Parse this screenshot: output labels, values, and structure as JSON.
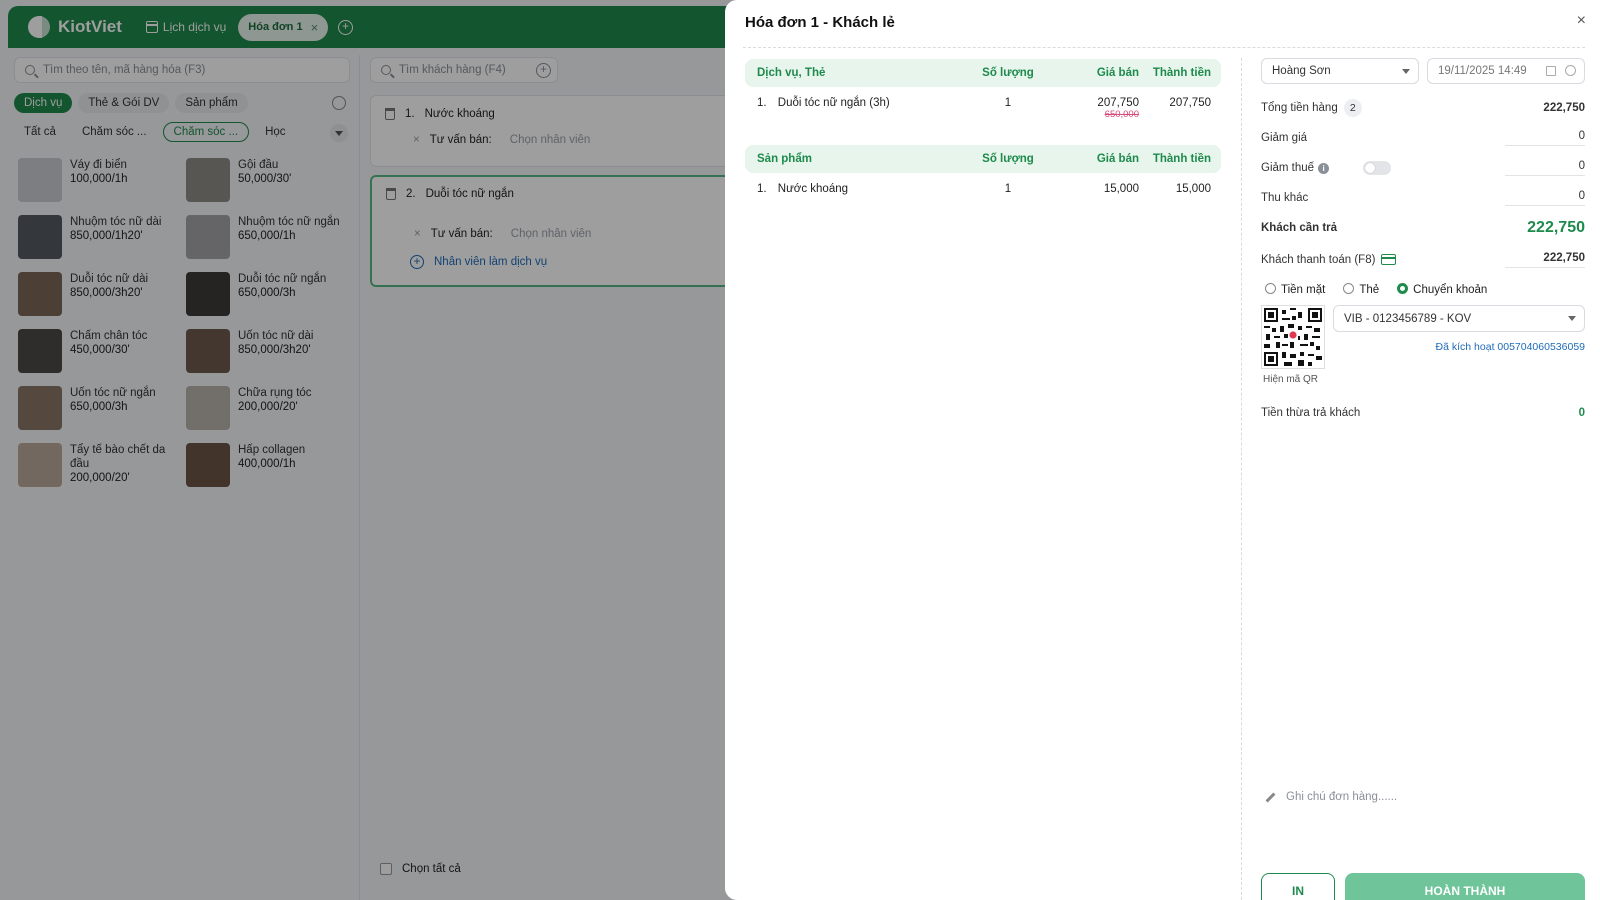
{
  "topbar": {
    "brand": "KiotViet",
    "nav_schedule": "Lịch dịch vụ",
    "active_tab": "Hóa đơn 1"
  },
  "left": {
    "search_placeholder": "Tìm theo tên, mã hàng hóa (F3)",
    "categories": [
      "Dịch vụ",
      "Thẻ & Gói DV",
      "Sản phẩm"
    ],
    "subcategories": [
      "Tất cả",
      "Chăm sóc ...",
      "Chăm sóc ...",
      "Học"
    ],
    "services": [
      {
        "name": "Váy đi biển",
        "price": "100,000/1h"
      },
      {
        "name": "Gội đầu",
        "price": "50,000/30'"
      },
      {
        "name": "Nhuộm tóc nữ dài",
        "price": "850,000/1h20'"
      },
      {
        "name": "Nhuộm tóc nữ ngắn",
        "price": "650,000/1h"
      },
      {
        "name": "Duỗi tóc nữ dài",
        "price": "850,000/3h20'"
      },
      {
        "name": "Duỗi tóc nữ ngắn",
        "price": "650,000/3h"
      },
      {
        "name": "Chấm chân tóc",
        "price": "450,000/30'"
      },
      {
        "name": "Uốn tóc nữ dài",
        "price": "850,000/3h20'"
      },
      {
        "name": "Uốn tóc nữ ngắn",
        "price": "650,000/3h"
      },
      {
        "name": "Chữa rụng tóc",
        "price": "200,000/20'"
      },
      {
        "name": "Tẩy tế bào chết da đầu",
        "price": "200,000/20'"
      },
      {
        "name": "Hấp collagen",
        "price": "400,000/1h"
      }
    ]
  },
  "middle": {
    "customer_placeholder": "Tìm khách hàng (F4)",
    "items": [
      {
        "index": "1.",
        "name": "Nước khoáng"
      },
      {
        "index": "2.",
        "name": "Duỗi tóc nữ ngắn"
      }
    ],
    "consultant_label": "Tư vấn bán:",
    "consultant_placeholder": "Chọn nhân viên",
    "add_staff": "Nhân viên làm dịch vụ",
    "select_all": "Chọn tất cả"
  },
  "drawer": {
    "title": "Hóa đơn 1 - Khách lẻ",
    "close": "×",
    "columns": {
      "qty": "Số lượng",
      "price": "Giá bán",
      "total": "Thành tiền"
    },
    "services_header": "Dịch vụ, Thẻ",
    "services": [
      {
        "index": "1.",
        "name": "Duỗi tóc nữ ngắn (3h)",
        "qty": "1",
        "price": "207,750",
        "old_price": "650,000",
        "total": "207,750"
      }
    ],
    "products_header": "Sản phẩm",
    "products": [
      {
        "index": "1.",
        "name": "Nước khoáng",
        "qty": "1",
        "price": "15,000",
        "total": "15,000"
      }
    ],
    "payment": {
      "staff": "Hoàng Sơn",
      "datetime": "19/11/2025 14:49",
      "total_goods_label": "Tổng tiền hàng",
      "total_goods_count": "2",
      "total_goods": "222,750",
      "discount_label": "Giảm giá",
      "discount": "0",
      "tax_label": "Giảm thuế",
      "tax": "0",
      "other_label": "Thu khác",
      "other": "0",
      "customer_pay_label": "Khách cần trả",
      "customer_pay": "222,750",
      "customer_paid_label": "Khách thanh toán (F8)",
      "customer_paid": "222,750",
      "methods": [
        "Tiền mặt",
        "Thẻ",
        "Chuyển khoản"
      ],
      "bank_account": "VIB - 0123456789 - KOV",
      "activated": "Đã kích hoạt 005704060536059",
      "qr_label": "Hiện mã QR",
      "change_label": "Tiền thừa trả khách",
      "change": "0",
      "note_placeholder": "Ghi chú đơn hàng......",
      "print_button": "IN",
      "complete_button": "HOÀN THÀNH"
    }
  },
  "colors": {
    "brand": "#1e8a4c",
    "accent_light": "#e7f5ec",
    "price_strike": "#d64a7a",
    "link": "#1e6bb8"
  }
}
